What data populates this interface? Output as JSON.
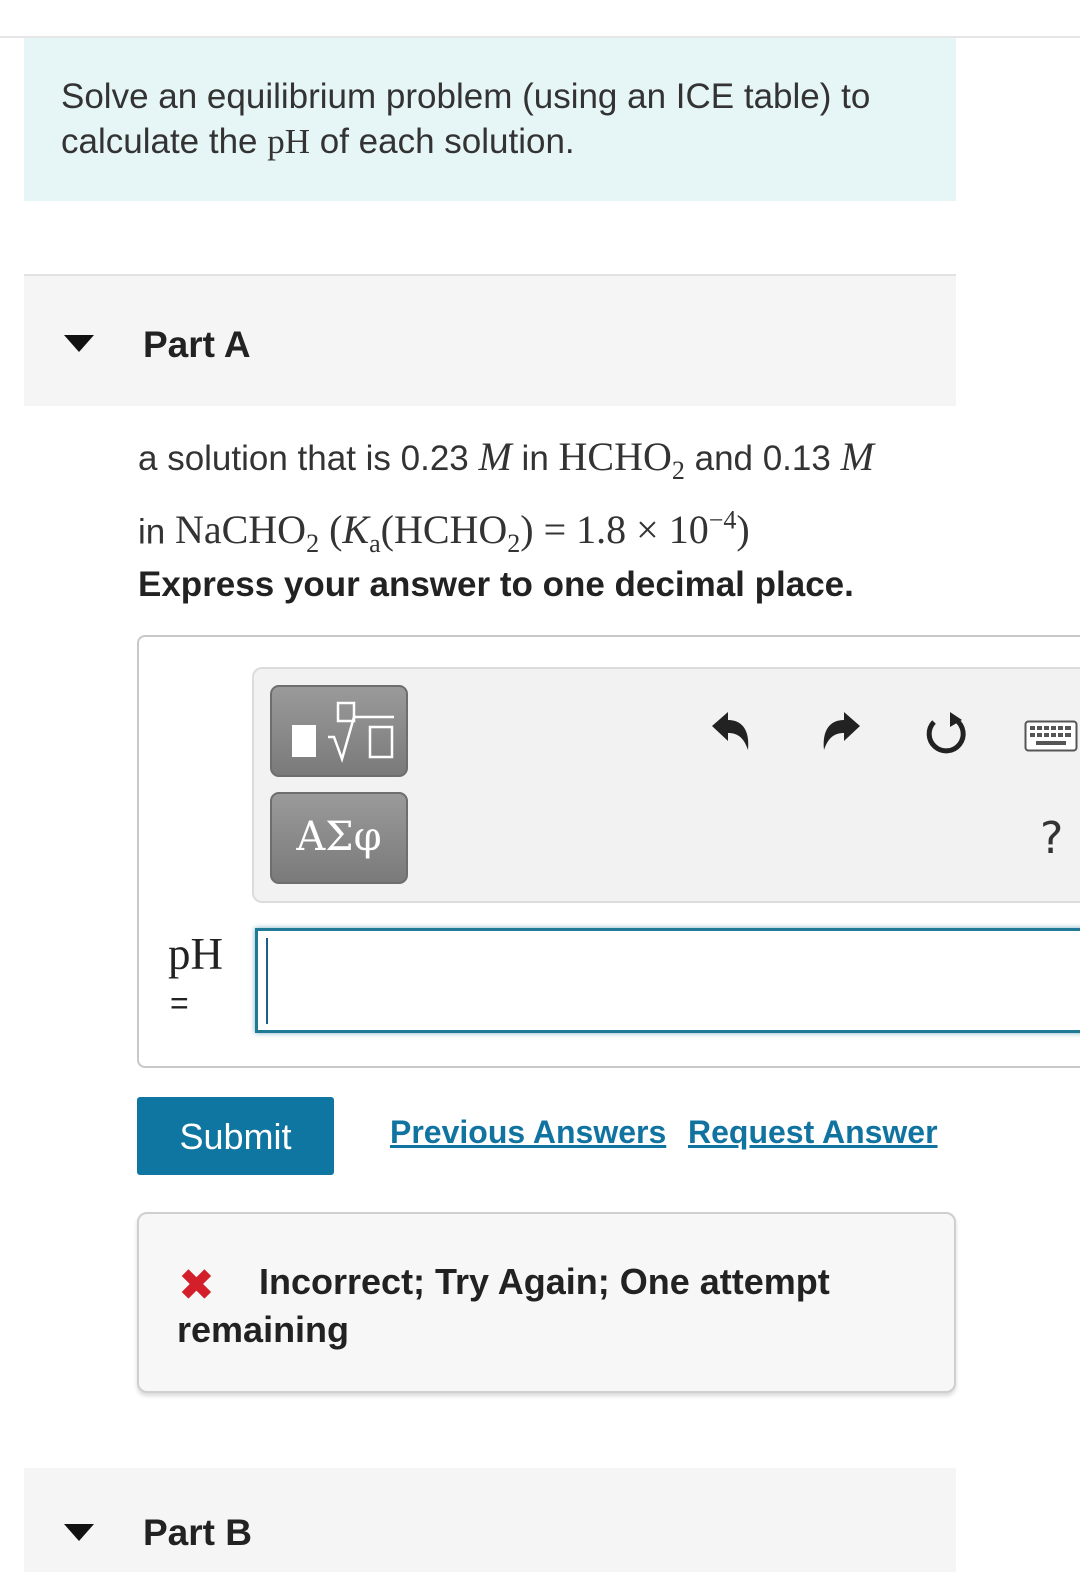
{
  "intro": {
    "text_before": "Solve an equilibrium problem (using an ICE table) to calculate the ",
    "math": "pH",
    "text_after": " of each solution."
  },
  "part_a": {
    "title": "Part A",
    "question": {
      "t1": "a solution that is 0.23 ",
      "m1": "M",
      "t2": " in ",
      "hcho": "HCHO",
      "sub2a": "2",
      "t3": " and 0.13 ",
      "m2": "M",
      "t4": "in ",
      "nacho": "NaCHO",
      "sub2b": "2",
      "ka_open": " (",
      "k": "K",
      "ka_sub": "a",
      "ka_mid": "(HCHO",
      "sub2c": "2",
      "ka_close": ") = 1.8 × 10",
      "exp": "−4",
      "end": ")"
    },
    "instruction": "Express your answer to one decimal place.",
    "toolbar": {
      "templates_icon": "templates-sqrt-icon",
      "symbols_label": "ΑΣφ",
      "undo_icon": "undo-icon",
      "redo_icon": "redo-icon",
      "reset_icon": "reset-icon",
      "keyboard_icon": "keyboard-icon",
      "help": "?"
    },
    "answer": {
      "label": "pH",
      "equals": "=",
      "value": ""
    },
    "submit_label": "Submit",
    "previous_answers_label": "Previous Answers",
    "request_answer_label": "Request Answer",
    "feedback": {
      "icon": "x-icon",
      "text": "Incorrect; Try Again; One attempt remaining",
      "color": "#d21f2a"
    }
  },
  "part_b": {
    "title": "Part B"
  },
  "colors": {
    "accent": "#0e76a0",
    "intro_bg": "#e6f5f5",
    "link": "#1173a0"
  }
}
